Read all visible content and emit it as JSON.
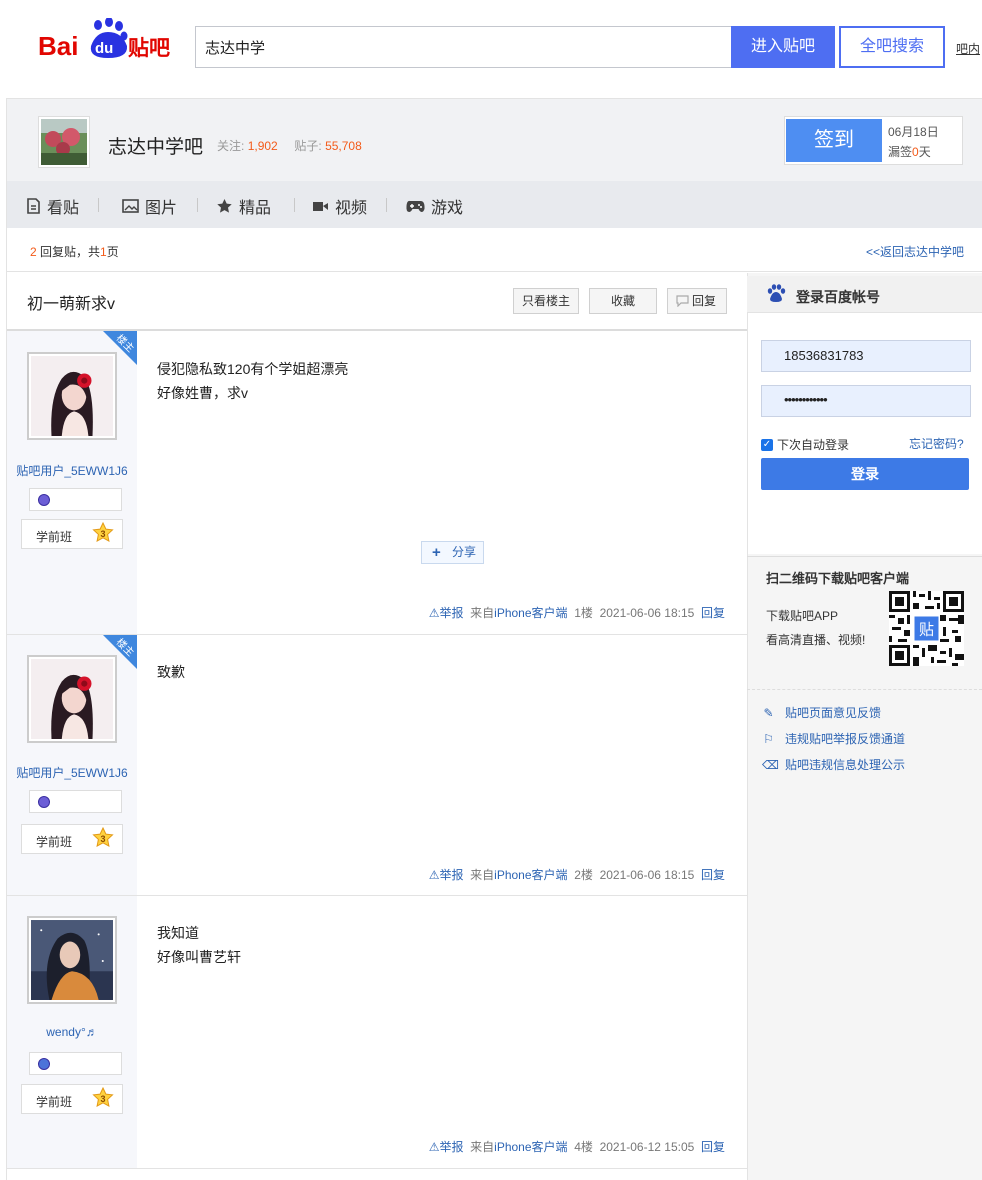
{
  "header": {
    "logo_text_1": "Bai",
    "logo_text_2": "du",
    "logo_text_3": "贴吧",
    "search_value": "志达中学",
    "enter_bar_label": "进入贴吧",
    "search_all_label": "全吧搜索",
    "search_in_bar_label": "吧内"
  },
  "forum": {
    "name": "志达中学吧",
    "follow_label": "关注:",
    "follow_count": "1,902",
    "posts_label": "贴子:",
    "posts_count": "55,708",
    "sign_label": "签到",
    "sign_date": "06月18日",
    "miss_prefix": "漏签",
    "miss_count": "0",
    "miss_suffix": "天"
  },
  "nav": {
    "items": [
      {
        "label": "看贴",
        "icon": "document-icon"
      },
      {
        "label": "图片",
        "icon": "image-icon"
      },
      {
        "label": "精品",
        "icon": "star-icon"
      },
      {
        "label": "视频",
        "icon": "video-icon"
      },
      {
        "label": "游戏",
        "icon": "gamepad-icon"
      }
    ]
  },
  "reply_bar": {
    "count": "2",
    "text_mid": "回复贴，共",
    "pages": "1",
    "text_end": "页",
    "back_link": "<<返回志达中学吧"
  },
  "thread": {
    "title": "初一萌新求v",
    "only_op_label": "只看楼主",
    "collect_label": "收藏",
    "reply_label": "回复"
  },
  "posts": [
    {
      "username": "贴吧用户_5EWW1J6",
      "level_name": "学前班",
      "level": "3",
      "op_tag": "楼主",
      "lines": [
        "侵犯隐私致120有个学姐超漂亮",
        "好像姓曹，求v"
      ],
      "share_label": "分享",
      "report": "举报",
      "source_prefix": "来自",
      "source": "iPhone客户端",
      "floor": "1楼",
      "time": "2021-06-06 18:15",
      "reply": "回复"
    },
    {
      "username": "贴吧用户_5EWW1J6",
      "level_name": "学前班",
      "level": "3",
      "op_tag": "楼主",
      "lines": [
        "致歉"
      ],
      "report": "举报",
      "source_prefix": "来自",
      "source": "iPhone客户端",
      "floor": "2楼",
      "time": "2021-06-06 18:15",
      "reply": "回复"
    },
    {
      "username": "wendy°♬",
      "level_name": "学前班",
      "level": "3",
      "lines": [
        "我知道",
        "好像叫曹艺轩"
      ],
      "report": "举报",
      "source_prefix": "来自",
      "source": "iPhone客户端",
      "floor": "4楼",
      "time": "2021-06-12 15:05",
      "reply": "回复"
    }
  ],
  "login": {
    "title": "登录百度帐号",
    "phone_value": "18536831783",
    "password_mask": "••••••••••••",
    "auto_login_label": "下次自动登录",
    "forgot_label": "忘记密码?",
    "login_button": "登录"
  },
  "qr": {
    "title": "扫二维码下载贴吧客户端",
    "line1": "下载贴吧APP",
    "line2": "看高清直播、视频!",
    "center_glyph": "贴"
  },
  "footer_links": [
    {
      "label": "贴吧页面意见反馈",
      "icon": "edit-icon"
    },
    {
      "label": "违规贴吧举报反馈通道",
      "icon": "alarm-icon"
    },
    {
      "label": "贴吧违规信息处理公示",
      "icon": "trash-icon"
    }
  ],
  "colors": {
    "brand_blue": "#4e6ef2",
    "link_blue": "#2d64b3",
    "accent_orange": "#f35b1a",
    "logo_red": "#e10601"
  }
}
